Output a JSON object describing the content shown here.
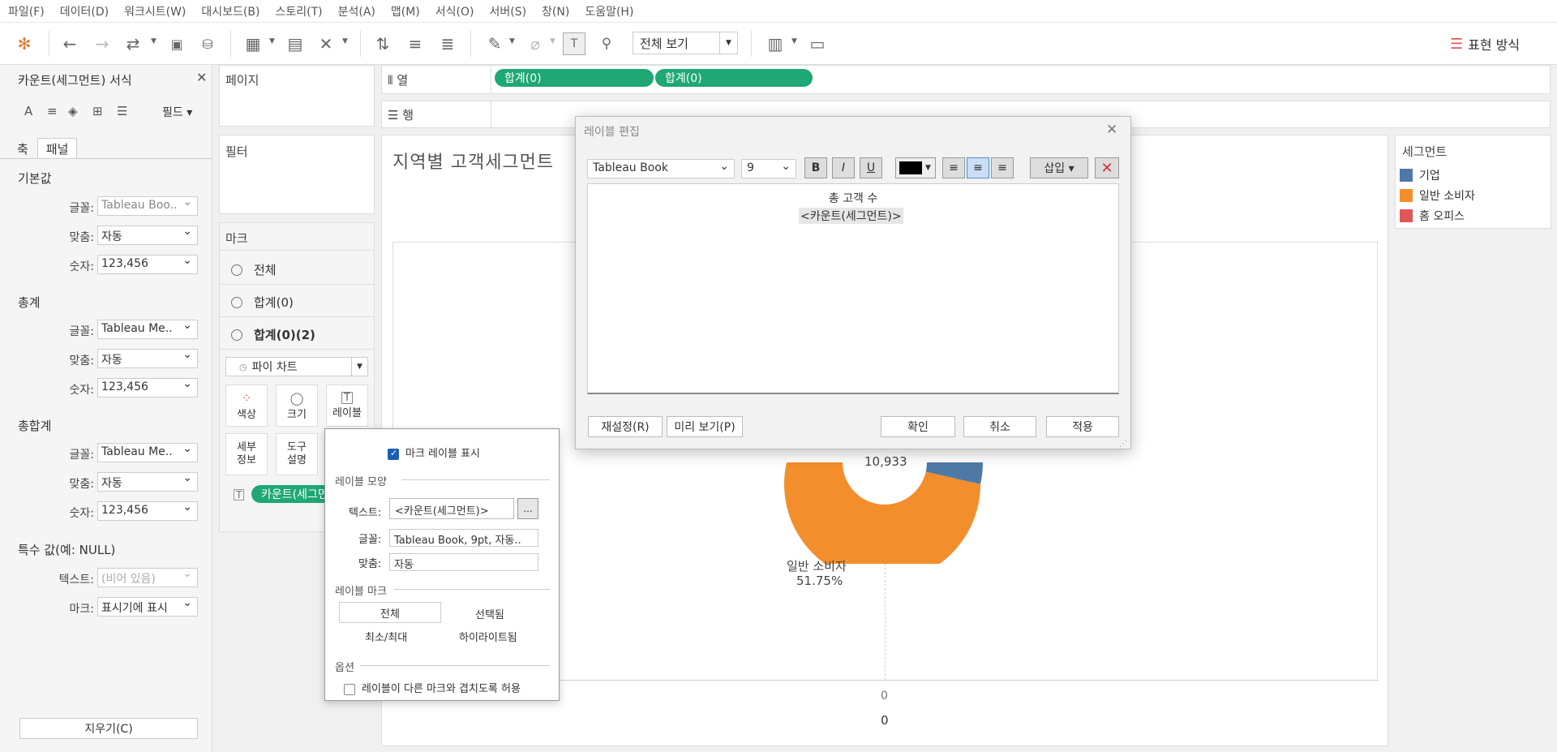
{
  "menu": [
    "파일(F)",
    "데이터(D)",
    "워크시트(W)",
    "대시보드(B)",
    "스토리(T)",
    "분석(A)",
    "맵(M)",
    "서식(O)",
    "서버(S)",
    "창(N)",
    "도움말(H)"
  ],
  "toolbar": {
    "fit": "전체 보기",
    "show_me": "표현 방식"
  },
  "format_pane": {
    "title": "카운트(세그먼트) 서식",
    "field_label": "필드 ▾",
    "tabs": [
      "축",
      "패널"
    ],
    "sections": [
      {
        "title": "기본값",
        "font": "Tableau Boo..",
        "align": "자동",
        "number": "123,456"
      },
      {
        "title": "총계",
        "font": "Tableau Me..",
        "align": "자동",
        "number": "123,456"
      },
      {
        "title": "총합계",
        "font": "Tableau Me..",
        "align": "자동",
        "number": "123,456"
      }
    ],
    "labels": {
      "font": "글꼴:",
      "align": "맞춤:",
      "number": "숫자:",
      "text": "텍스트:",
      "mark": "마크:"
    },
    "special_title": "특수 값(예: NULL)",
    "special_text_placeholder": "(비어 있음)",
    "special_mark": "표시기에 표시",
    "clear_button": "지우기(C)"
  },
  "shelves": {
    "pages": "페이지",
    "filters": "필터",
    "columns_label": "열",
    "rows_label": "행",
    "column_pills": [
      "합계(0)",
      "합계(0)"
    ]
  },
  "marks": {
    "title": "마크",
    "rows": [
      "전체",
      "합계(0)",
      "합계(0)(2)"
    ],
    "mark_type": "파이 차트",
    "buttons": [
      "색상",
      "크기",
      "레이블"
    ],
    "buttons2": [
      [
        "세부",
        "정보"
      ],
      [
        "도구",
        "설명"
      ]
    ],
    "pill": "카운트(세그먼트)"
  },
  "view": {
    "title": "지역별 고객세그먼트",
    "center_value": "10,933",
    "slice_label": "일반 소비자",
    "slice_pct": "51.75%",
    "axis_zero": "0",
    "axis_bottom": "0"
  },
  "legend": {
    "title": "세그먼트",
    "items": [
      {
        "label": "기업",
        "color": "#4e79a7"
      },
      {
        "label": "일반 소비자",
        "color": "#f28e2b"
      },
      {
        "label": "홈 오피스",
        "color": "#e15759"
      }
    ]
  },
  "dialog": {
    "title": "레이블 편집",
    "font": "Tableau Book",
    "size": "9",
    "insert": "삽입 ▾",
    "line1": "총 고객 수",
    "line2": "<카운트(세그먼트)>",
    "reset": "재설정(R)",
    "preview": "미리 보기(P)",
    "ok": "확인",
    "cancel": "취소",
    "apply": "적용"
  },
  "popover": {
    "show_labels": "마크 레이블 표시",
    "appearance": "레이블 모양",
    "text_label": "텍스트:",
    "text_value": "<카운트(세그먼트)>",
    "font_label": "글꼴:",
    "font_value": "Tableau Book, 9pt, 자동..",
    "align_label": "맞춤:",
    "align_value": "자동",
    "marks_title": "레이블 마크",
    "opt_all": "전체",
    "opt_selected": "선택됨",
    "opt_minmax": "최소/최대",
    "opt_highlight": "하이라이트됨",
    "options_title": "옵션",
    "overlap": "레이블이 다른 마크와 겹치도록 허용"
  }
}
